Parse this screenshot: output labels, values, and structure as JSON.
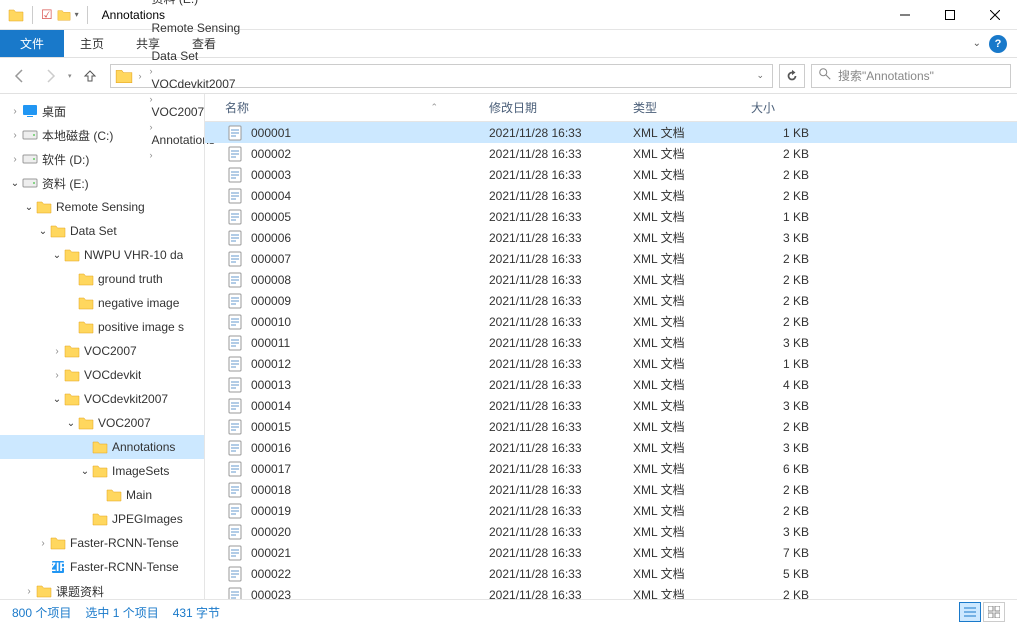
{
  "window": {
    "title": "Annotations"
  },
  "ribbon": {
    "file": "文件",
    "home": "主页",
    "share": "共享",
    "view": "查看"
  },
  "nav": {
    "crumbs": [
      "资料 (E:)",
      "Remote Sensing",
      "Data Set",
      "VOCdevkit2007",
      "VOC2007",
      "Annotations"
    ],
    "search_placeholder": "搜索\"Annotations\""
  },
  "tree": [
    {
      "depth": 0,
      "icon": "desktop",
      "label": "桌面",
      "twisty": ">"
    },
    {
      "depth": 0,
      "icon": "drive",
      "label": "本地磁盘 (C:)",
      "twisty": ">"
    },
    {
      "depth": 0,
      "icon": "drive",
      "label": "软件 (D:)",
      "twisty": ">"
    },
    {
      "depth": 0,
      "icon": "drive",
      "label": "资料 (E:)",
      "twisty": "v"
    },
    {
      "depth": 1,
      "icon": "folder",
      "label": "Remote Sensing",
      "twisty": "v"
    },
    {
      "depth": 2,
      "icon": "folder",
      "label": "Data Set",
      "twisty": "v"
    },
    {
      "depth": 3,
      "icon": "folder",
      "label": "NWPU VHR-10 da",
      "twisty": "v"
    },
    {
      "depth": 4,
      "icon": "folder",
      "label": "ground truth",
      "twisty": ""
    },
    {
      "depth": 4,
      "icon": "folder",
      "label": "negative image",
      "twisty": ""
    },
    {
      "depth": 4,
      "icon": "folder",
      "label": "positive image s",
      "twisty": ""
    },
    {
      "depth": 3,
      "icon": "folder",
      "label": "VOC2007",
      "twisty": ">"
    },
    {
      "depth": 3,
      "icon": "folder",
      "label": "VOCdevkit",
      "twisty": ">"
    },
    {
      "depth": 3,
      "icon": "folder",
      "label": "VOCdevkit2007",
      "twisty": "v"
    },
    {
      "depth": 4,
      "icon": "folder",
      "label": "VOC2007",
      "twisty": "v"
    },
    {
      "depth": 5,
      "icon": "folder",
      "label": "Annotations",
      "twisty": "",
      "selected": true
    },
    {
      "depth": 5,
      "icon": "folder",
      "label": "ImageSets",
      "twisty": "v"
    },
    {
      "depth": 6,
      "icon": "folder",
      "label": "Main",
      "twisty": ""
    },
    {
      "depth": 5,
      "icon": "folder",
      "label": "JPEGImages",
      "twisty": ""
    },
    {
      "depth": 2,
      "icon": "folder",
      "label": "Faster-RCNN-Tense",
      "twisty": ">"
    },
    {
      "depth": 2,
      "icon": "zip",
      "label": "Faster-RCNN-Tense",
      "twisty": ""
    },
    {
      "depth": 1,
      "icon": "folder",
      "label": "课题资料",
      "twisty": ">"
    }
  ],
  "columns": {
    "name": "名称",
    "date": "修改日期",
    "type": "类型",
    "size": "大小"
  },
  "files": [
    {
      "name": "000001",
      "date": "2021/11/28 16:33",
      "type": "XML 文档",
      "size": "1 KB",
      "selected": true
    },
    {
      "name": "000002",
      "date": "2021/11/28 16:33",
      "type": "XML 文档",
      "size": "2 KB"
    },
    {
      "name": "000003",
      "date": "2021/11/28 16:33",
      "type": "XML 文档",
      "size": "2 KB"
    },
    {
      "name": "000004",
      "date": "2021/11/28 16:33",
      "type": "XML 文档",
      "size": "2 KB"
    },
    {
      "name": "000005",
      "date": "2021/11/28 16:33",
      "type": "XML 文档",
      "size": "1 KB"
    },
    {
      "name": "000006",
      "date": "2021/11/28 16:33",
      "type": "XML 文档",
      "size": "3 KB"
    },
    {
      "name": "000007",
      "date": "2021/11/28 16:33",
      "type": "XML 文档",
      "size": "2 KB"
    },
    {
      "name": "000008",
      "date": "2021/11/28 16:33",
      "type": "XML 文档",
      "size": "2 KB"
    },
    {
      "name": "000009",
      "date": "2021/11/28 16:33",
      "type": "XML 文档",
      "size": "2 KB"
    },
    {
      "name": "000010",
      "date": "2021/11/28 16:33",
      "type": "XML 文档",
      "size": "2 KB"
    },
    {
      "name": "000011",
      "date": "2021/11/28 16:33",
      "type": "XML 文档",
      "size": "3 KB"
    },
    {
      "name": "000012",
      "date": "2021/11/28 16:33",
      "type": "XML 文档",
      "size": "1 KB"
    },
    {
      "name": "000013",
      "date": "2021/11/28 16:33",
      "type": "XML 文档",
      "size": "4 KB"
    },
    {
      "name": "000014",
      "date": "2021/11/28 16:33",
      "type": "XML 文档",
      "size": "3 KB"
    },
    {
      "name": "000015",
      "date": "2021/11/28 16:33",
      "type": "XML 文档",
      "size": "2 KB"
    },
    {
      "name": "000016",
      "date": "2021/11/28 16:33",
      "type": "XML 文档",
      "size": "3 KB"
    },
    {
      "name": "000017",
      "date": "2021/11/28 16:33",
      "type": "XML 文档",
      "size": "6 KB"
    },
    {
      "name": "000018",
      "date": "2021/11/28 16:33",
      "type": "XML 文档",
      "size": "2 KB"
    },
    {
      "name": "000019",
      "date": "2021/11/28 16:33",
      "type": "XML 文档",
      "size": "2 KB"
    },
    {
      "name": "000020",
      "date": "2021/11/28 16:33",
      "type": "XML 文档",
      "size": "3 KB"
    },
    {
      "name": "000021",
      "date": "2021/11/28 16:33",
      "type": "XML 文档",
      "size": "7 KB"
    },
    {
      "name": "000022",
      "date": "2021/11/28 16:33",
      "type": "XML 文档",
      "size": "5 KB"
    },
    {
      "name": "000023",
      "date": "2021/11/28 16:33",
      "type": "XML 文档",
      "size": "2 KB"
    }
  ],
  "status": {
    "items": "800 个项目",
    "selected": "选中 1 个项目",
    "bytes": "431 字节"
  }
}
